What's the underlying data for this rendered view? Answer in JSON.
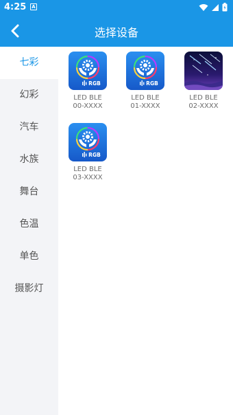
{
  "status": {
    "time": "4:25",
    "notif": "A"
  },
  "header": {
    "title": "选择设备"
  },
  "sidebar": {
    "items": [
      {
        "label": "七彩",
        "active": true
      },
      {
        "label": "幻彩"
      },
      {
        "label": "汽车"
      },
      {
        "label": "水族"
      },
      {
        "label": "舞台"
      },
      {
        "label": "色温"
      },
      {
        "label": "单色"
      },
      {
        "label": "摄影灯"
      }
    ]
  },
  "devices": [
    {
      "line1": "LED BLE",
      "line2": "00-XXXX",
      "icon": "rgb-gear-hands-icon",
      "badge": "RGB"
    },
    {
      "line1": "LED BLE",
      "line2": "01-XXXX",
      "icon": "rgb-gear-hands-icon",
      "badge": "RGB"
    },
    {
      "line1": "LED BLE",
      "line2": "02-XXXX",
      "icon": "meteor-night-sky-icon"
    },
    {
      "line1": "LED BLE",
      "line2": "03-XXXX",
      "icon": "rgb-gear-hands-icon",
      "badge": "RGB"
    }
  ],
  "colors": {
    "primary": "#1a96e6",
    "sidebar_bg": "#f3f4f7",
    "text_gray": "#6b6b6b"
  }
}
